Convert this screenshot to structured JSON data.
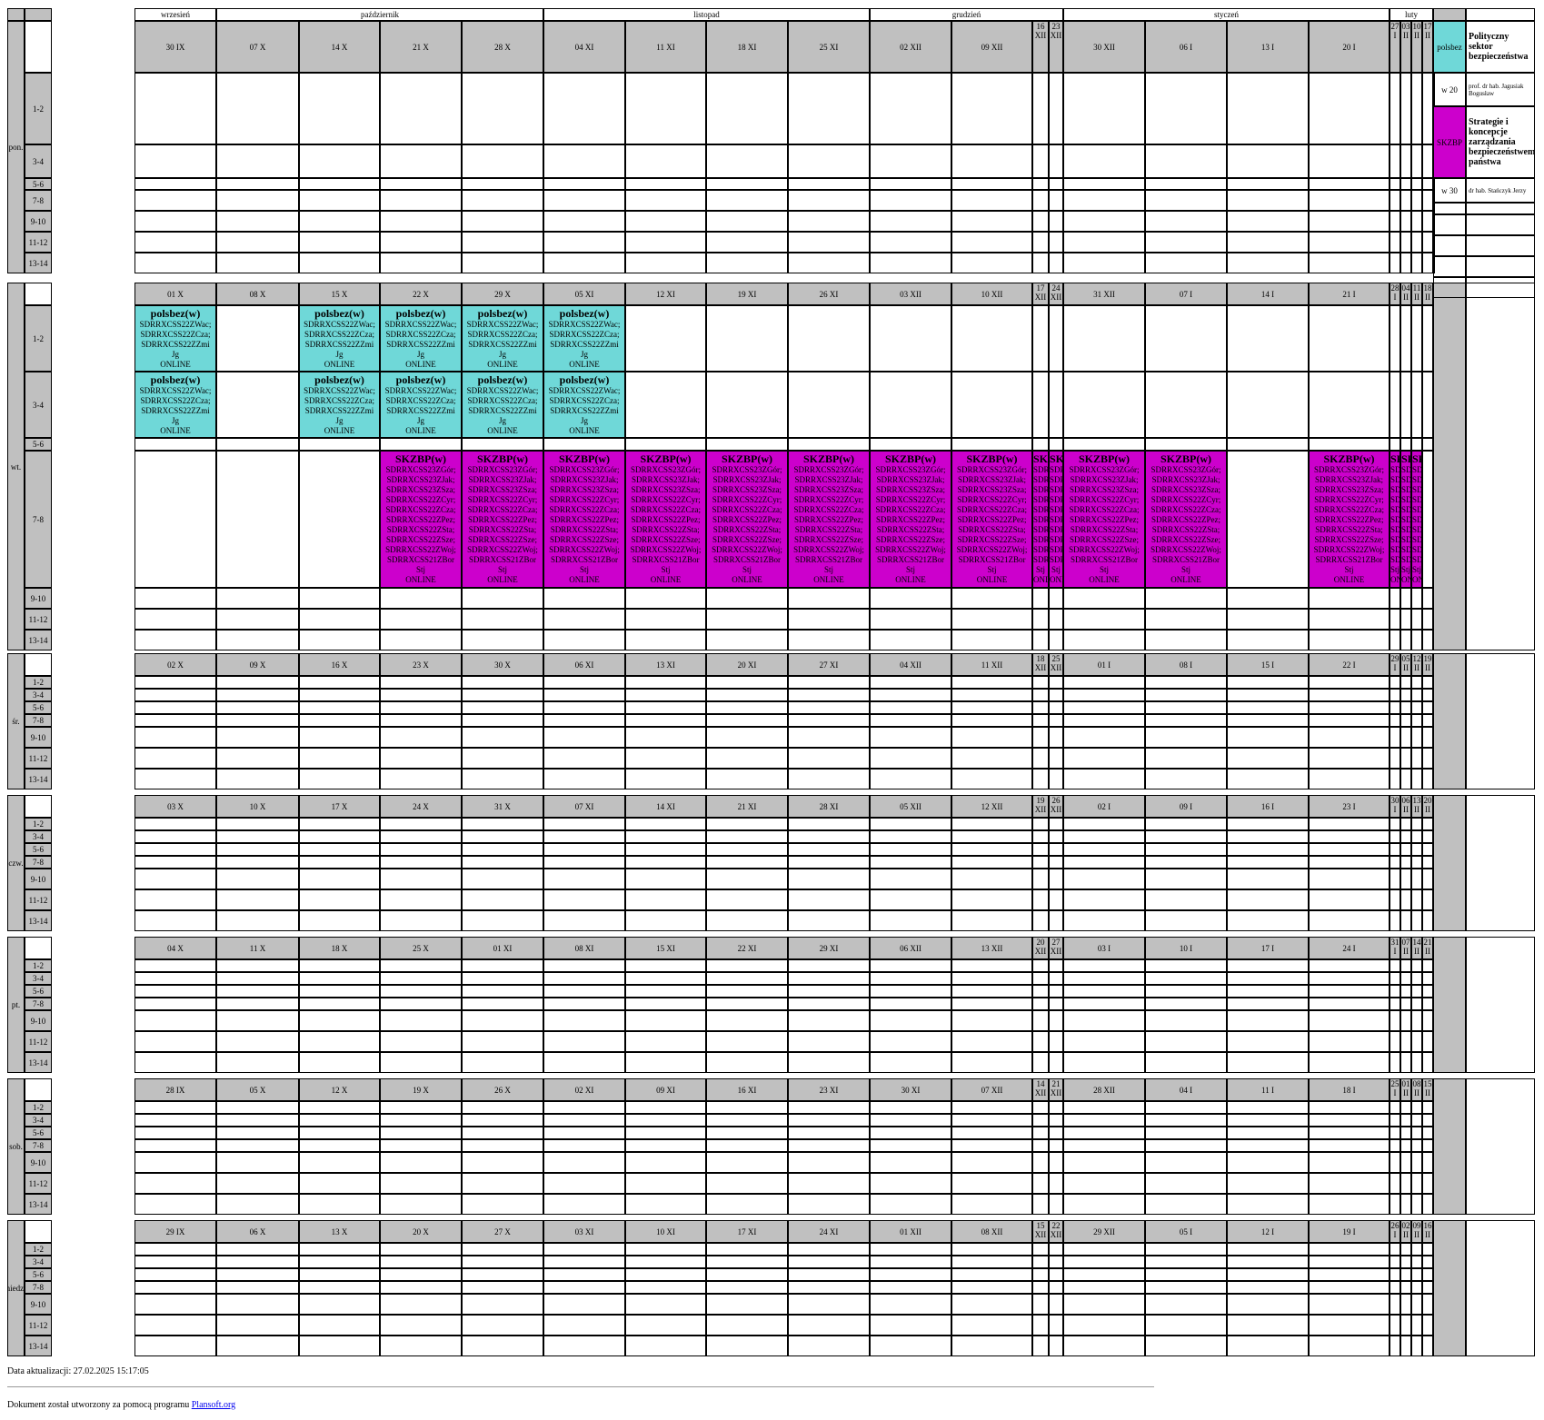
{
  "months": [
    "wrzesień",
    "październik",
    "listopad",
    "grudzień",
    "styczeń",
    "luty"
  ],
  "days": [
    {
      "label": "pon.",
      "dates": [
        "30 IX",
        "07 X",
        "14 X",
        "21 X",
        "28 X",
        "04 XI",
        "11 XI",
        "18 XI",
        "25 XI",
        "02 XII",
        "09 XII",
        "16 XII",
        "23 XII",
        "30 XII",
        "06 I",
        "13 I",
        "20 I",
        "27 I",
        "03 II",
        "10 II",
        "17 II",
        "24 II"
      ]
    },
    {
      "label": "wt.",
      "dates": [
        "01 X",
        "08 X",
        "15 X",
        "22 X",
        "29 X",
        "05 XI",
        "12 XI",
        "19 XI",
        "26 XI",
        "03 XII",
        "10 XII",
        "17 XII",
        "24 XII",
        "31 XII",
        "07 I",
        "14 I",
        "21 I",
        "28 I",
        "04 II",
        "11 II",
        "18 II",
        "25 II"
      ]
    },
    {
      "label": "śr.",
      "dates": [
        "02 X",
        "09 X",
        "16 X",
        "23 X",
        "30 X",
        "06 XI",
        "13 XI",
        "20 XI",
        "27 XI",
        "04 XII",
        "11 XII",
        "18 XII",
        "25 XII",
        "01 I",
        "08 I",
        "15 I",
        "22 I",
        "29 I",
        "05 II",
        "12 II",
        "19 II",
        "26 II"
      ]
    },
    {
      "label": "czw.",
      "dates": [
        "03 X",
        "10 X",
        "17 X",
        "24 X",
        "31 X",
        "07 XI",
        "14 XI",
        "21 XI",
        "28 XI",
        "05 XII",
        "12 XII",
        "19 XII",
        "26 XII",
        "02 I",
        "09 I",
        "16 I",
        "23 I",
        "30 I",
        "06 II",
        "13 II",
        "20 II",
        "27 II"
      ]
    },
    {
      "label": "pt.",
      "dates": [
        "04 X",
        "11 X",
        "18 X",
        "25 X",
        "01 XI",
        "08 XI",
        "15 XI",
        "22 XI",
        "29 XI",
        "06 XII",
        "13 XII",
        "20 XII",
        "27 XII",
        "03 I",
        "10 I",
        "17 I",
        "24 I",
        "31 I",
        "07 II",
        "14 II",
        "21 II",
        "28 II"
      ]
    },
    {
      "label": "sob.",
      "dates": [
        "28 IX",
        "05 X",
        "12 X",
        "19 X",
        "26 X",
        "02 XI",
        "09 XI",
        "16 XI",
        "23 XI",
        "30 XI",
        "07 XII",
        "14 XII",
        "21 XII",
        "28 XII",
        "04 I",
        "11 I",
        "18 I",
        "25 I",
        "01 II",
        "08 II",
        "15 II",
        "22 II"
      ]
    },
    {
      "label": "niedz.",
      "dates": [
        "29 IX",
        "06 X",
        "13 X",
        "20 X",
        "27 X",
        "03 XI",
        "10 XI",
        "17 XI",
        "24 XI",
        "01 XII",
        "08 XII",
        "15 XII",
        "22 XII",
        "29 XII",
        "05 I",
        "12 I",
        "19 I",
        "26 I",
        "02 II",
        "09 II",
        "16 II",
        "23 II"
      ]
    }
  ],
  "slots": [
    "1-2",
    "3-4",
    "5-6",
    "7-8",
    "9-10",
    "11-12",
    "13-14"
  ],
  "events": {
    "polsbez": {
      "title": "polsbez(w)",
      "lines": [
        "SDRRXCSS22ZWac;",
        "SDRRXCSS22ZCza;",
        "SDRRXCSS22ZZmi",
        "Jg",
        "ONLINE"
      ],
      "color": "#6fd8d8"
    },
    "skzbp": {
      "title": "SKZBP(w)",
      "lines": [
        "SDRRXCSS23ZGór;",
        "SDRRXCSS23ZJak;",
        "SDRRXCSS23ZSza;",
        "SDRRXCSS22ZCyr;",
        "SDRRXCSS22ZCza;",
        "SDRRXCSS22ZPez;",
        "SDRRXCSS22ZSta;",
        "SDRRXCSS22ZSze;",
        "SDRRXCSS22ZWoj;",
        "SDRRXCSS21ZBor",
        "Stj",
        "ONLINE"
      ],
      "color": "#cc00cc"
    }
  },
  "legend": [
    {
      "code": "polsbez",
      "name": "Polityczny sektor bezpieczeństwa",
      "hours": "w 20",
      "teacher": "prof. dr hab. Jagusiak Bogusław",
      "color": "#6fd8d8"
    },
    {
      "code": "SKZBP",
      "name": "Strategie i koncepcje zarządzania bezpieczeństwem państwa",
      "hours": "w 30",
      "teacher": "dr hab. Stańczyk Jerzy",
      "color": "#cc00cc"
    }
  ],
  "footer": {
    "updated": "Data aktualizacji: 27.02.2025 15:17:05",
    "created_by": "Dokument został utworzony za pomocą programu",
    "link": "Plansoft.org"
  }
}
